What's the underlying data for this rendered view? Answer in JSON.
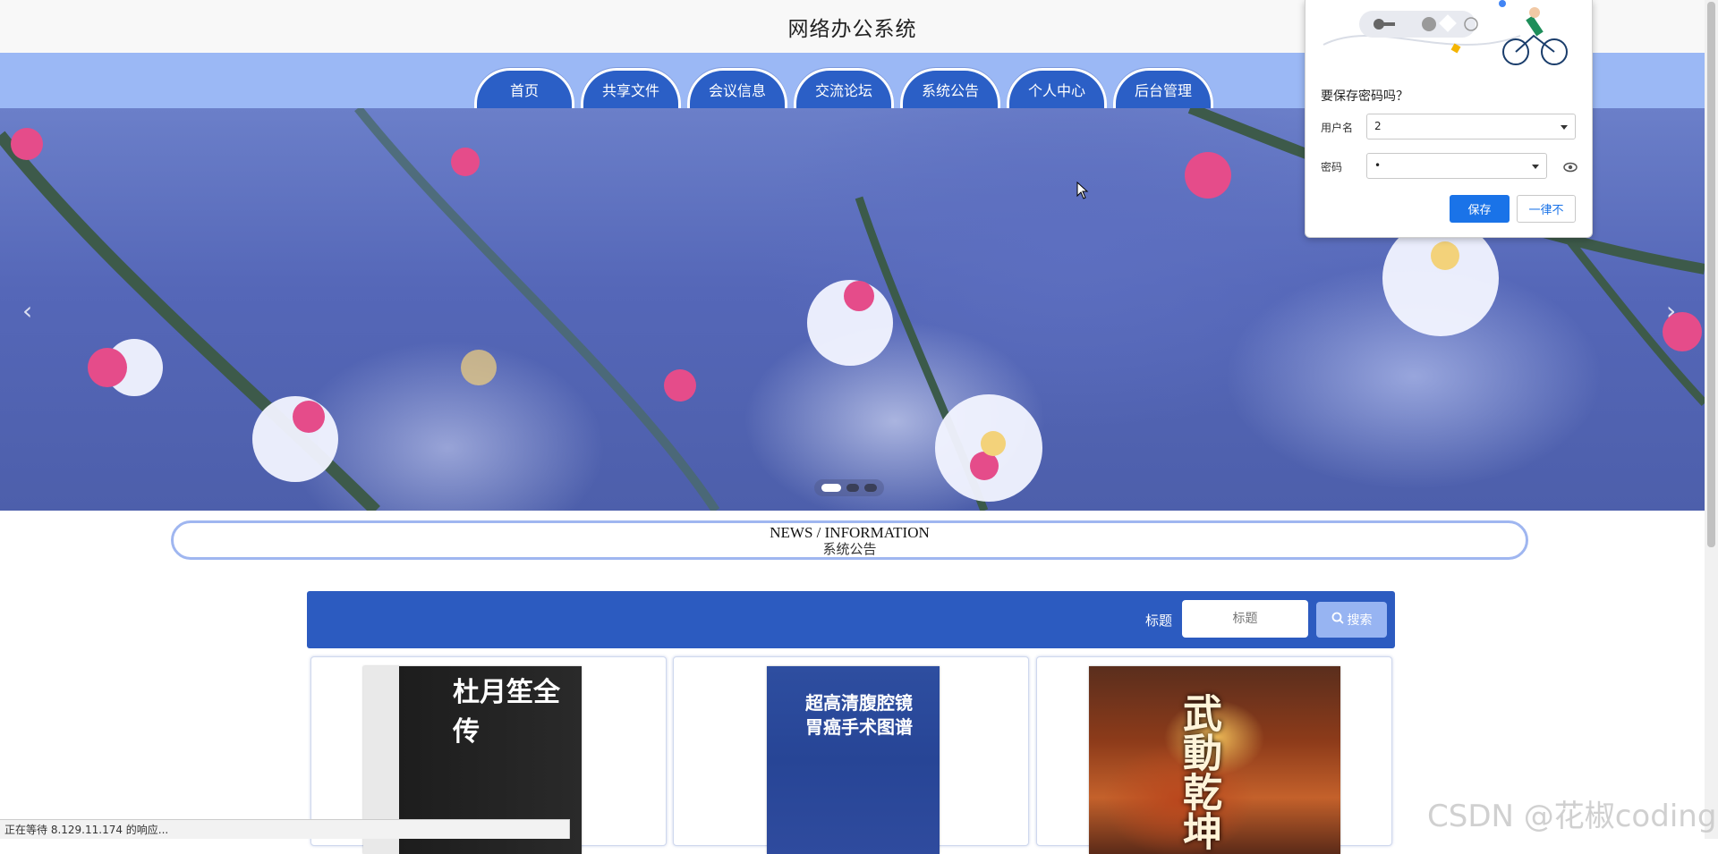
{
  "site": {
    "title": "网络办公系统"
  },
  "nav": {
    "items": [
      {
        "label": "首页"
      },
      {
        "label": "共享文件"
      },
      {
        "label": "会议信息"
      },
      {
        "label": "交流论坛"
      },
      {
        "label": "系统公告"
      },
      {
        "label": "个人中心"
      },
      {
        "label": "后台管理"
      }
    ]
  },
  "banner": {
    "prev_icon": "chevron-left-icon",
    "next_icon": "chevron-right-icon",
    "slide_count": 3,
    "active_slide": 1
  },
  "news": {
    "title_en": "NEWS / INFORMATION",
    "title_cn": "系统公告"
  },
  "search": {
    "label": "标题",
    "placeholder": "标题",
    "button_label": "搜索",
    "icon": "search-icon"
  },
  "cards": [
    {
      "cover_title": "杜月笙全传"
    },
    {
      "cover_title": "超高清腹腔镜 胃癌手术图谱"
    },
    {
      "cover_title": "武動乾坤"
    }
  ],
  "password_prompt": {
    "question": "要保存密码吗？",
    "username_label": "用户名",
    "username_value": "2",
    "password_label": "密码",
    "password_value": "•",
    "save_label": "保存",
    "never_label": "一律不",
    "accent": "#1a73e8"
  },
  "status": {
    "text": "正在等待 8.129.11.174 的响应..."
  },
  "watermark": {
    "text": "CSDN @花椒coding"
  },
  "colors": {
    "nav_bg": "#9bb8f5",
    "tab_bg": "#2b5fc6",
    "search_bar": "#2c5bc0",
    "search_btn": "#97b4f2"
  }
}
